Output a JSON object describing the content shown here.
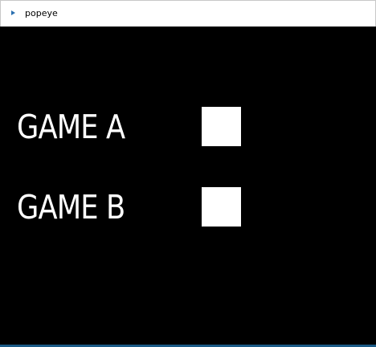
{
  "window": {
    "title": "popeye",
    "icon": "app-arrow-icon",
    "accent_color": "#1a5a86"
  },
  "menu": {
    "items": [
      {
        "label": "GAME A"
      },
      {
        "label": "GAME B"
      }
    ]
  },
  "colors": {
    "background": "#000000",
    "text": "#ffffff",
    "selector_box": "#ffffff"
  }
}
